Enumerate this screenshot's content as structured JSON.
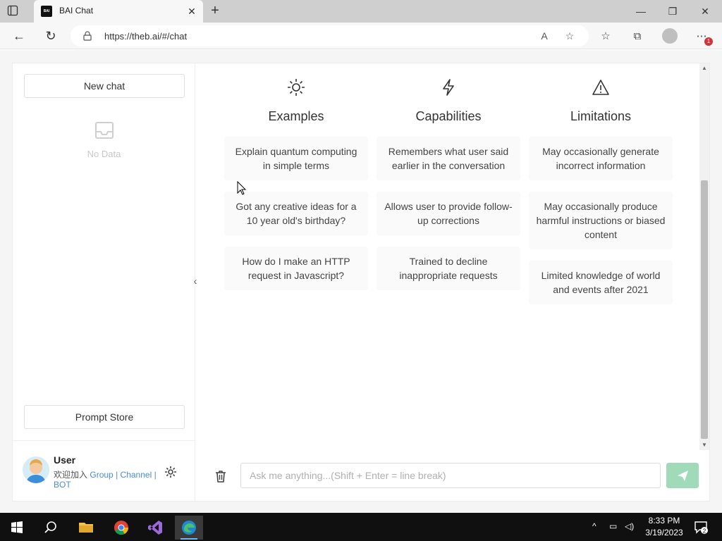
{
  "browser": {
    "tab_title": "BAI Chat",
    "tab_favicon_text": "BAI",
    "url": "https://theb.ai/#/chat",
    "notification_count": "1"
  },
  "sidebar": {
    "new_chat_label": "New chat",
    "empty_text": "No Data",
    "prompt_store_label": "Prompt Store",
    "user": {
      "name": "User",
      "join_text": "欢迎加入",
      "link_group": "Group",
      "link_channel": "Channel",
      "link_bot": "BOT",
      "separator": "|"
    }
  },
  "columns": [
    {
      "title": "Examples",
      "icon": "sun-icon",
      "cards": [
        "Explain quantum computing in simple terms",
        "Got any creative ideas for a 10 year old's birthday?",
        "How do I make an HTTP request in Javascript?"
      ]
    },
    {
      "title": "Capabilities",
      "icon": "lightning-icon",
      "cards": [
        "Remembers what user said earlier in the conversation",
        "Allows user to provide follow-up corrections",
        "Trained to decline inappropriate requests"
      ]
    },
    {
      "title": "Limitations",
      "icon": "warning-icon",
      "cards": [
        "May occasionally generate incorrect information",
        "May occasionally produce harmful instructions or biased content",
        "Limited knowledge of world and events after 2021"
      ]
    }
  ],
  "chat": {
    "placeholder": "Ask me anything...(Shift + Enter = line break)",
    "value": ""
  },
  "taskbar": {
    "time": "8:33 PM",
    "date": "3/19/2023",
    "apps": [
      "file-explorer",
      "chrome",
      "visual-studio",
      "edge"
    ]
  },
  "colors": {
    "send_button": "#9fdbb9",
    "link": "#4a8ad8",
    "taskbar": "#101010"
  }
}
